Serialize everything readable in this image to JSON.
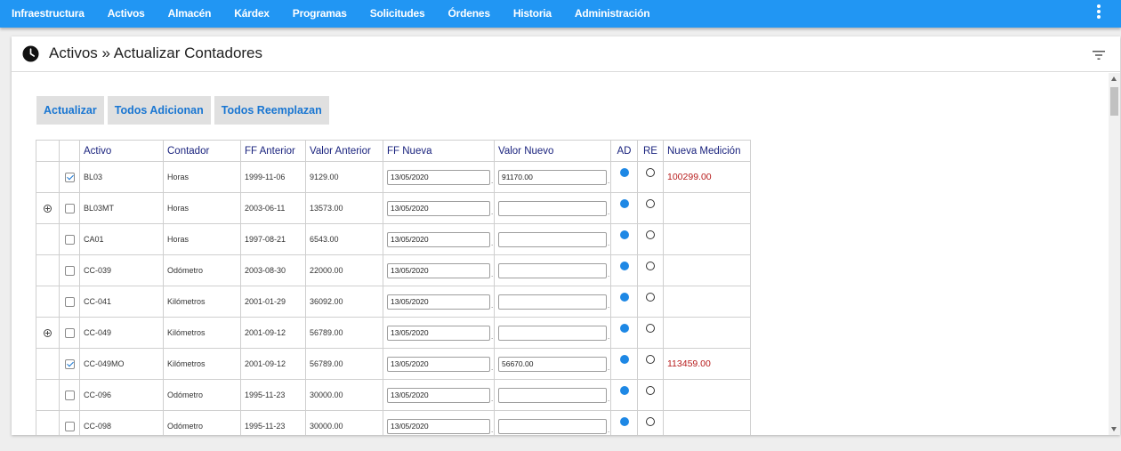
{
  "nav": {
    "items": [
      "Infraestructura",
      "Activos",
      "Almacén",
      "Kárdex",
      "Programas",
      "Solicitudes",
      "Órdenes",
      "Historia",
      "Administración"
    ]
  },
  "page": {
    "title": "Activos » Actualizar Contadores"
  },
  "buttons": {
    "actualizar": "Actualizar",
    "todos_adicionan": "Todos Adicionan",
    "todos_reemplazan": "Todos Reemplazan"
  },
  "table": {
    "headers": {
      "activo": "Activo",
      "contador": "Contador",
      "ff_anterior": "FF Anterior",
      "valor_anterior": "Valor Anterior",
      "ff_nueva": "FF Nueva",
      "valor_nuevo": "Valor Nuevo",
      "ad": "AD",
      "re": "RE",
      "nueva_medicion": "Nueva Medición"
    },
    "rows": [
      {
        "expandable": false,
        "checked": true,
        "activo": "BL03",
        "contador": "Horas",
        "ff_anterior": "1999-11-06",
        "valor_anterior": "9129.00",
        "ff_nueva": "13/05/2020",
        "valor_nuevo": "91170.00",
        "mode": "AD",
        "nueva_medicion": "100299.00"
      },
      {
        "expandable": true,
        "checked": false,
        "activo": "BL03MT",
        "contador": "Horas",
        "ff_anterior": "2003-06-11",
        "valor_anterior": "13573.00",
        "ff_nueva": "13/05/2020",
        "valor_nuevo": "",
        "mode": "AD",
        "nueva_medicion": ""
      },
      {
        "expandable": false,
        "checked": false,
        "activo": "CA01",
        "contador": "Horas",
        "ff_anterior": "1997-08-21",
        "valor_anterior": "6543.00",
        "ff_nueva": "13/05/2020",
        "valor_nuevo": "",
        "mode": "AD",
        "nueva_medicion": ""
      },
      {
        "expandable": false,
        "checked": false,
        "activo": "CC-039",
        "contador": "Odómetro",
        "ff_anterior": "2003-08-30",
        "valor_anterior": "22000.00",
        "ff_nueva": "13/05/2020",
        "valor_nuevo": "",
        "mode": "AD",
        "nueva_medicion": ""
      },
      {
        "expandable": false,
        "checked": false,
        "activo": "CC-041",
        "contador": "Kilómetros",
        "ff_anterior": "2001-01-29",
        "valor_anterior": "36092.00",
        "ff_nueva": "13/05/2020",
        "valor_nuevo": "",
        "mode": "AD",
        "nueva_medicion": ""
      },
      {
        "expandable": true,
        "checked": false,
        "activo": "CC-049",
        "contador": "Kilómetros",
        "ff_anterior": "2001-09-12",
        "valor_anterior": "56789.00",
        "ff_nueva": "13/05/2020",
        "valor_nuevo": "",
        "mode": "AD",
        "nueva_medicion": ""
      },
      {
        "expandable": false,
        "checked": true,
        "activo": "CC-049MO",
        "contador": "Kilómetros",
        "ff_anterior": "2001-09-12",
        "valor_anterior": "56789.00",
        "ff_nueva": "13/05/2020",
        "valor_nuevo": "56670.00",
        "mode": "AD",
        "nueva_medicion": "113459.00"
      },
      {
        "expandable": false,
        "checked": false,
        "activo": "CC-096",
        "contador": "Odómetro",
        "ff_anterior": "1995-11-23",
        "valor_anterior": "30000.00",
        "ff_nueva": "13/05/2020",
        "valor_nuevo": "",
        "mode": "AD",
        "nueva_medicion": ""
      },
      {
        "expandable": false,
        "checked": false,
        "activo": "CC-098",
        "contador": "Odómetro",
        "ff_anterior": "1995-11-23",
        "valor_anterior": "30000.00",
        "ff_nueva": "13/05/2020",
        "valor_nuevo": "",
        "mode": "AD",
        "nueva_medicion": ""
      }
    ]
  },
  "icons": {
    "title_icon": "clock-icon",
    "filter_icon": "filter-icon",
    "menu_icon": "more-vert-icon",
    "expand_icon": "expand-plus-icon"
  },
  "colors": {
    "nav_bg": "#2196f3",
    "button_text": "#1976d2",
    "header_text": "#1a237e",
    "new_measure": "#b71c1c",
    "radio_on": "#1e88e5"
  }
}
